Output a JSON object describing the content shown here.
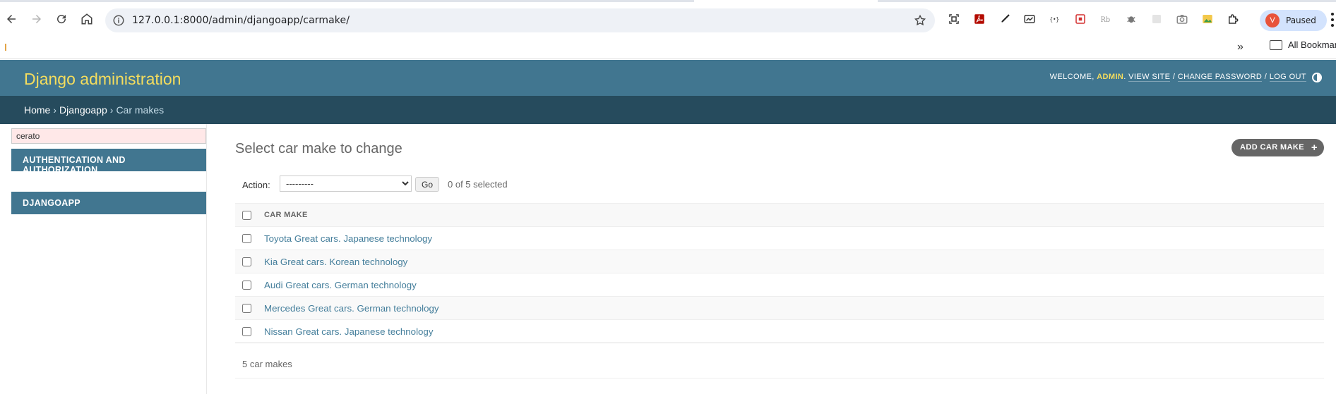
{
  "browser": {
    "url": "127.0.0.1:8000/admin/djangoapp/carmake/",
    "profile_initial": "V",
    "profile_status": "Paused",
    "bookmarks_overflow": "»",
    "all_bookmarks_label": "All Bookmarks",
    "extensions": [
      "screenshot-icon",
      "pdf-icon",
      "eyedropper-icon",
      "gauge-icon",
      "json-icon",
      "bookmark-icon",
      "rb-icon",
      "bug-icon",
      "blank-extension-icon",
      "camera-icon",
      "image-icon",
      "puzzle-icon"
    ]
  },
  "header": {
    "branding": "Django administration",
    "welcome": "Welcome,",
    "username": "admin",
    "view_site": "View site",
    "change_password": "Change password",
    "log_out": "Log out",
    "sep": "/"
  },
  "breadcrumbs": {
    "home": "Home",
    "app": "Djangoapp",
    "current": "Car makes",
    "separator": "›"
  },
  "sidebar": {
    "filter_value": "cerato",
    "modules": [
      {
        "caption": "Authentication and Authorization"
      },
      {
        "caption": "Djangoapp"
      }
    ]
  },
  "content": {
    "title": "Select car make to change",
    "add_button": "Add car make",
    "add_icon": "+",
    "action_label": "Action:",
    "action_selected": "---------",
    "go_label": "Go",
    "counter": "0 of 5 selected",
    "column_header": "Car make",
    "rows": [
      "Toyota Great cars. Japanese technology",
      "Kia Great cars. Korean technology",
      "Audi Great cars. German technology",
      "Mercedes Great cars. German technology",
      "Nissan Great cars. Japanese technology"
    ],
    "result_count": "5 car makes"
  },
  "colors": {
    "header_bg": "#417690",
    "breadcrumb_bg": "#264b5d",
    "branding": "#f5dd5d",
    "link": "#447e9b"
  }
}
